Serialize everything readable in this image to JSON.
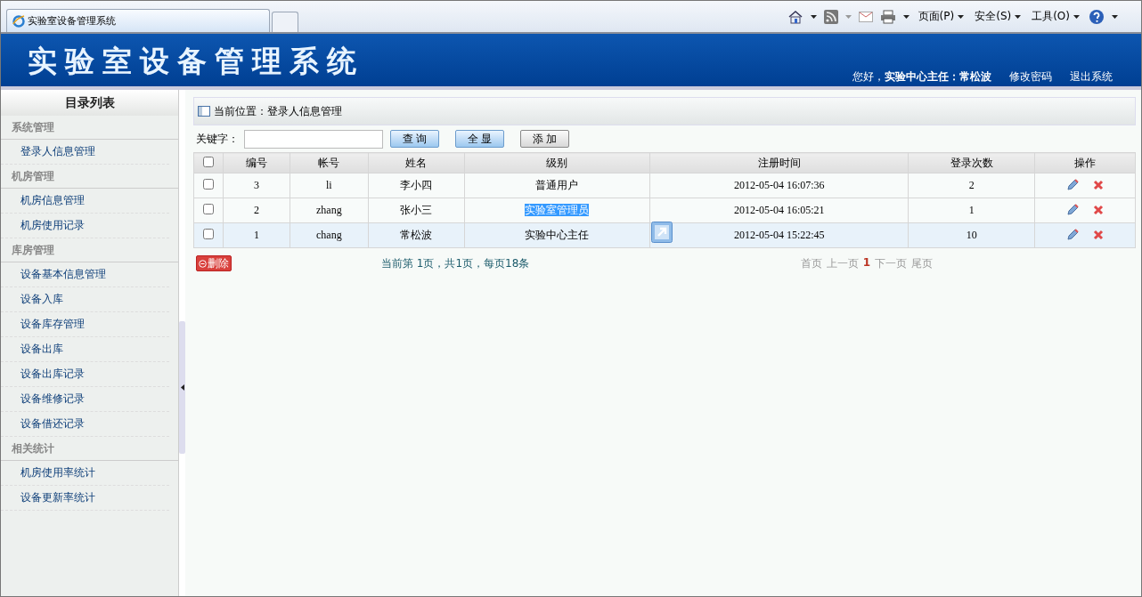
{
  "browser": {
    "tab_title": "实验室设备管理系统",
    "menus": [
      {
        "label": "页面(P)"
      },
      {
        "label": "安全(S)"
      },
      {
        "label": "工具(O)"
      }
    ]
  },
  "header": {
    "title": "实验室设备管理系统",
    "greeting": "您好，",
    "user": "实验中心主任：常松波",
    "links": [
      "修改密码",
      "退出系统"
    ]
  },
  "sidebar": {
    "title": "目录列表",
    "groups": [
      {
        "label": "系统管理",
        "items": [
          {
            "label": "登录人信息管理"
          }
        ]
      },
      {
        "label": "机房管理",
        "items": [
          {
            "label": "机房信息管理"
          },
          {
            "label": "机房使用记录"
          }
        ]
      },
      {
        "label": "库房管理",
        "items": [
          {
            "label": "设备基本信息管理"
          },
          {
            "label": "设备入库"
          },
          {
            "label": "设备库存管理"
          },
          {
            "label": "设备出库"
          },
          {
            "label": "设备出库记录"
          },
          {
            "label": "设备维修记录"
          },
          {
            "label": "设备借还记录"
          }
        ]
      },
      {
        "label": "相关统计",
        "items": [
          {
            "label": "机房使用率统计"
          },
          {
            "label": "设备更新率统计"
          }
        ]
      }
    ]
  },
  "breadcrumb": "当前位置：登录人信息管理",
  "search": {
    "label": "关键字：",
    "buttons": [
      "查 询",
      "全 显",
      "添 加"
    ]
  },
  "table": {
    "select_all": false,
    "columns": [
      "编号",
      "帐号",
      "姓名",
      "级别",
      "注册时间",
      "登录次数",
      "操作"
    ],
    "rows": [
      {
        "checked": false,
        "highlighted": false,
        "text_selected": false,
        "cells": [
          "3",
          "li",
          "李小四",
          "普通用户",
          "2012-05-04 16:07:36",
          "2"
        ]
      },
      {
        "checked": false,
        "highlighted": false,
        "text_selected": true,
        "cells": [
          "2",
          "zhang",
          "张小三",
          "实验室管理员",
          "2012-05-04 16:05:21",
          "1"
        ]
      },
      {
        "checked": false,
        "highlighted": true,
        "text_selected": false,
        "cells": [
          "1",
          "chang",
          "常松波",
          "实验中心主任",
          "2012-05-04 15:22:45",
          "10"
        ]
      }
    ]
  },
  "footer": {
    "delete_button": "删除",
    "page_info": "当前第 1页，共1页，每页18条",
    "pager": [
      {
        "label": "首页",
        "current": false
      },
      {
        "label": "上一页",
        "current": false
      },
      {
        "label": "1",
        "current": true
      },
      {
        "label": "下一页",
        "current": false
      },
      {
        "label": "尾页",
        "current": false
      }
    ]
  }
}
